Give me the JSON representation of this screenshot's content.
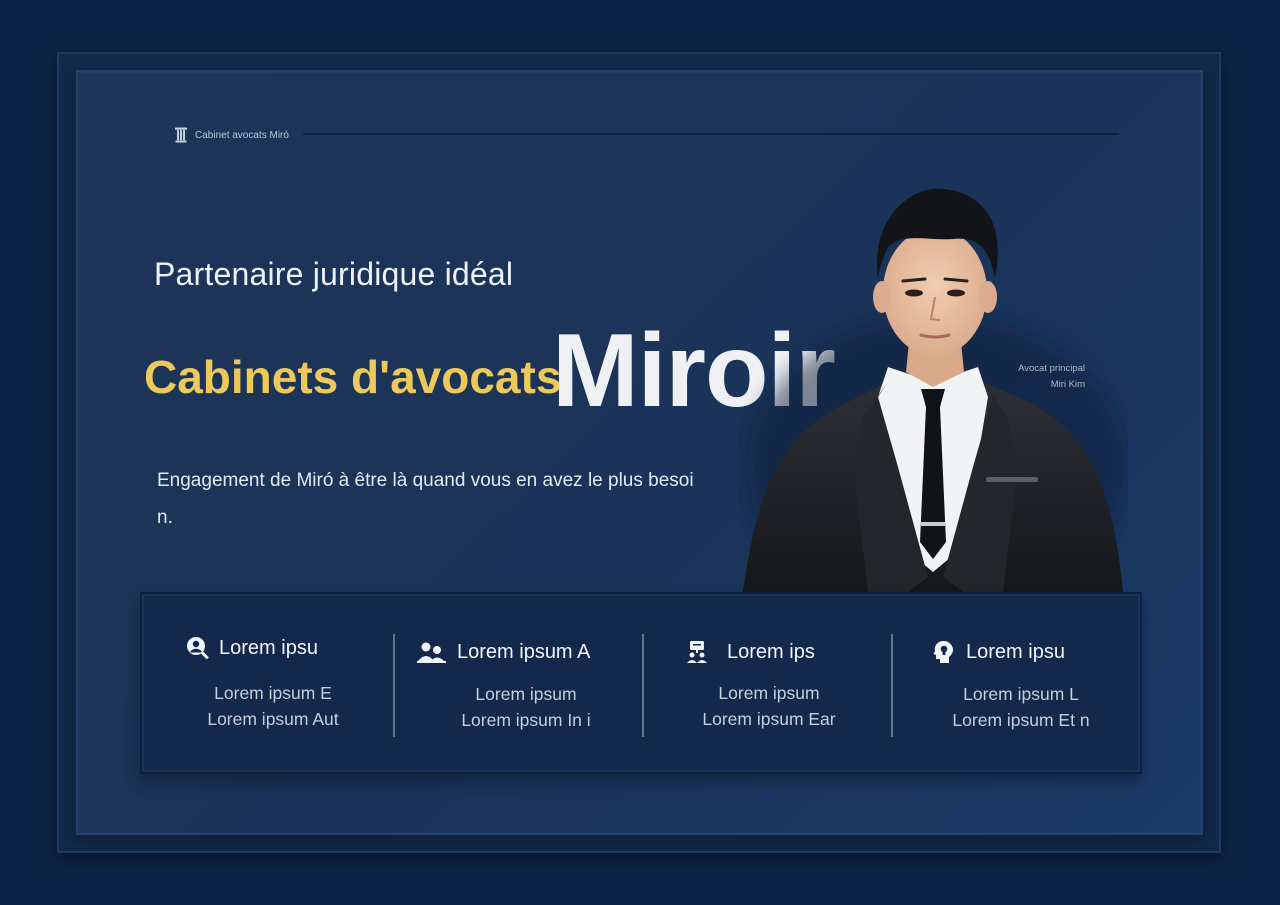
{
  "brand": {
    "name": "Cabinet avocats Miró",
    "icon": "pillar-icon"
  },
  "hero": {
    "subtitle": "Partenaire juridique idéal",
    "title_gold": "Cabinets d'avocats",
    "title_big": "Miroir",
    "description": "Engagement de Miró à être là quand vous en avez le plus besoin."
  },
  "lawyer": {
    "role": "Avocat principal",
    "name": "Miri Kim"
  },
  "features": [
    {
      "icon": "user-search-icon",
      "title": "Lorem ipsu",
      "line1": "Lorem ipsum E",
      "line2": "Lorem ipsum Aut"
    },
    {
      "icon": "team-icon",
      "title": "Lorem ipsum A",
      "line1": "Lorem ipsum",
      "line2": "Lorem ipsum In i"
    },
    {
      "icon": "presenter-icon",
      "title": "Lorem ips",
      "line1": "Lorem ipsum",
      "line2": "Lorem ipsum Ear"
    },
    {
      "icon": "idea-head-icon",
      "title": "Lorem ipsu",
      "line1": "Lorem ipsum L",
      "line2": "Lorem ipsum Et n"
    }
  ],
  "colors": {
    "background": "#0e2446",
    "slide": "#1e3558",
    "gold": "#ecc95a",
    "text": "#eef2f8"
  }
}
